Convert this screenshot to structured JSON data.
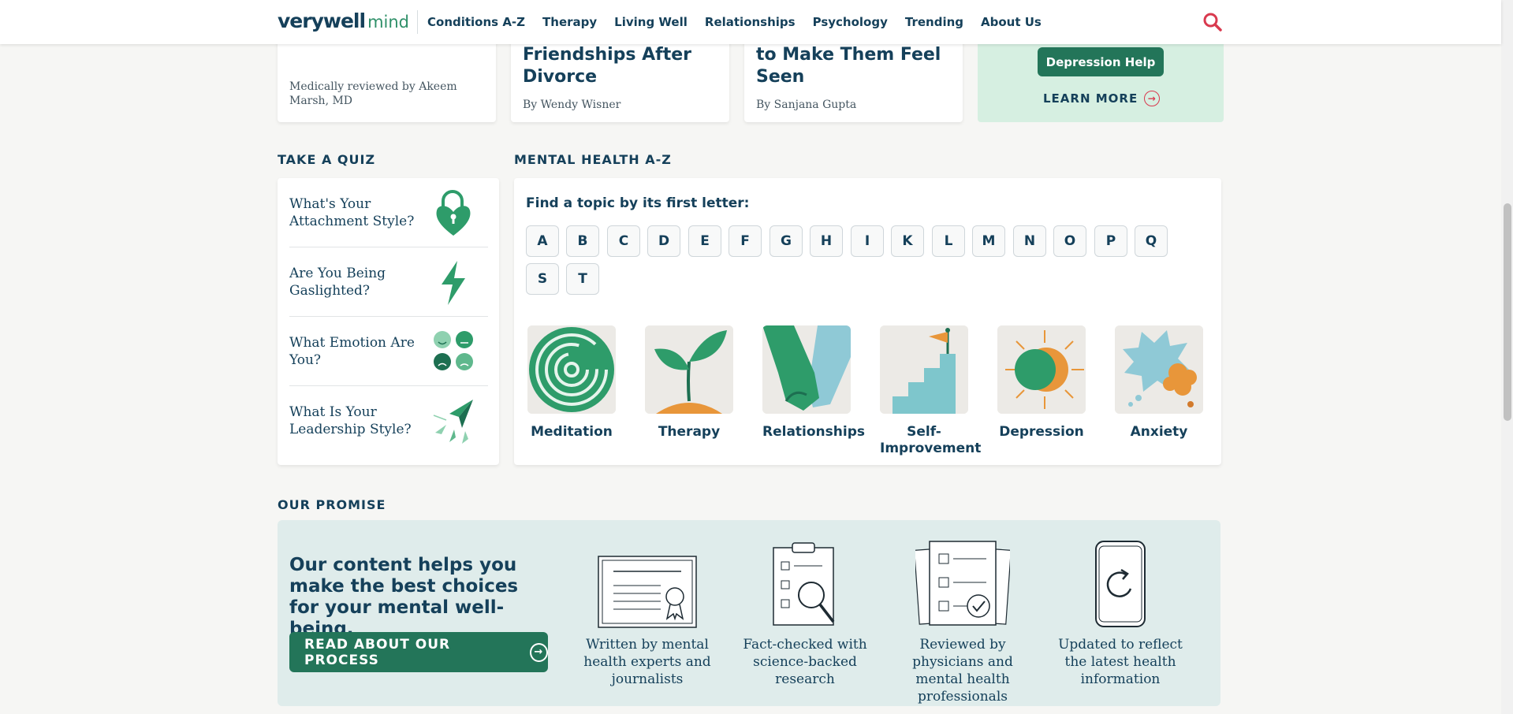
{
  "header": {
    "logo_main": "verywell",
    "logo_sub": "mind",
    "nav": [
      "Conditions A-Z",
      "Therapy",
      "Living Well",
      "Relationships",
      "Psychology",
      "Trending",
      "About Us"
    ]
  },
  "top_cards": [
    {
      "meta": "Medically reviewed by Akeem Marsh, MD"
    },
    {
      "title": "Friendships After Divorce",
      "byline": "By Wendy Wisner"
    },
    {
      "title": "to Make Them Feel Seen",
      "byline": "By Sanjana Gupta"
    }
  ],
  "promo": {
    "button": "Depression Help",
    "learn_more": "LEARN MORE"
  },
  "quiz": {
    "label": "TAKE A QUIZ",
    "items": [
      {
        "title": "What's Your Attachment Style?",
        "icon": "lock-heart-icon"
      },
      {
        "title": "Are You Being Gaslighted?",
        "icon": "lightning-icon"
      },
      {
        "title": "What Emotion Are You?",
        "icon": "emotion-faces-icon"
      },
      {
        "title": "What Is Your Leadership Style?",
        "icon": "paper-planes-icon"
      }
    ]
  },
  "az": {
    "label": "MENTAL HEALTH A-Z",
    "find": "Find a topic by its first letter:",
    "letters": [
      "A",
      "B",
      "C",
      "D",
      "E",
      "F",
      "G",
      "H",
      "I",
      "K",
      "L",
      "M",
      "N",
      "O",
      "P",
      "Q",
      "S",
      "T"
    ],
    "topics": [
      "Meditation",
      "Therapy",
      "Relationships",
      "Self-Improvement",
      "Depression",
      "Anxiety"
    ]
  },
  "promise": {
    "label": "OUR PROMISE",
    "headline": "Our content helps you make the best choices for your mental well-being.",
    "button": "READ ABOUT OUR PROCESS",
    "items": [
      "Written by mental health experts and journalists",
      "Fact-checked with science-backed research",
      "Reviewed by physicians and mental health professionals",
      "Updated to reflect the latest health information"
    ]
  },
  "colors": {
    "brand_green": "#237559",
    "navy": "#15405a",
    "accent_red": "#d93a4f"
  }
}
